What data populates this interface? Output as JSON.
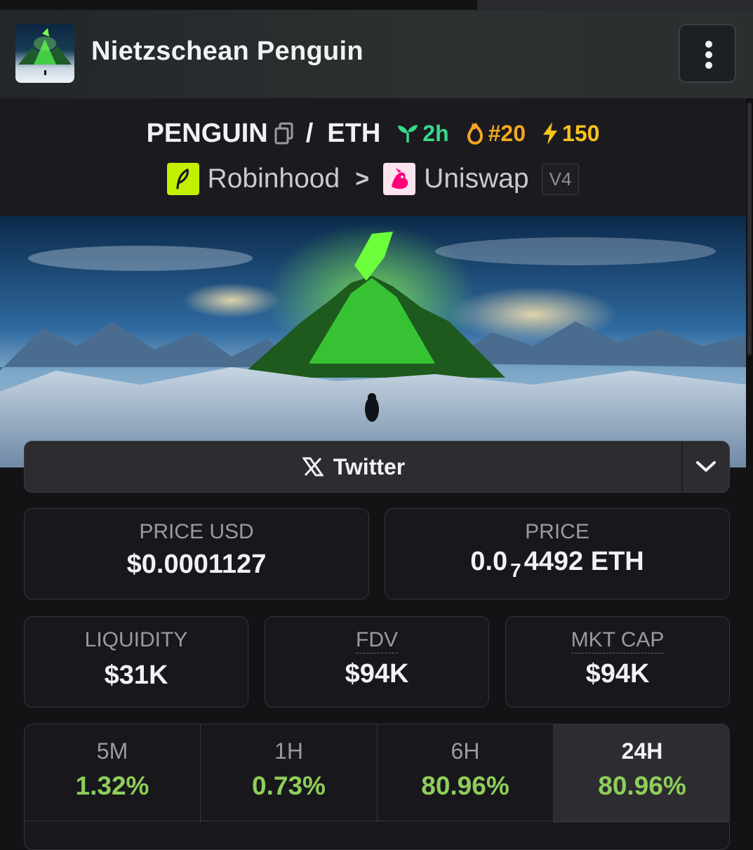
{
  "header": {
    "title": "Nietzschean Penguin"
  },
  "pair": {
    "base": "PENGUIN",
    "quote": "ETH",
    "age": "2h",
    "rank": "#20",
    "boosts": "150"
  },
  "dex": {
    "chain": "Robinhood",
    "name": "Uniswap",
    "version": "V4"
  },
  "socials": {
    "twitter_label": "Twitter"
  },
  "stats": {
    "price_usd_label": "PRICE USD",
    "price_usd": "$0.0001127",
    "price_label": "PRICE",
    "price_lead": "0.0",
    "price_zeros": "7",
    "price_tail": "4492 ETH",
    "liquidity_label": "LIQUIDITY",
    "liquidity": "$31K",
    "fdv_label": "FDV",
    "fdv": "$94K",
    "mktcap_label": "MKT CAP",
    "mktcap": "$94K"
  },
  "changes": [
    {
      "period": "5M",
      "value": "1.32%"
    },
    {
      "period": "1H",
      "value": "0.73%"
    },
    {
      "period": "6H",
      "value": "80.96%"
    },
    {
      "period": "24H",
      "value": "80.96%",
      "active": true
    }
  ],
  "colors": {
    "accent_green": "#39d98a",
    "rank_orange": "#f5a623",
    "boost_yellow": "#f8c21c",
    "change_green": "#8fce5a",
    "robinhood_green": "#c2f000",
    "uniswap_pink": "#ff007a"
  },
  "icons": {
    "copy": "copy-icon",
    "age": "seedling-icon",
    "rank": "flame-icon",
    "boost": "lightning-icon",
    "menu": "kebab-menu-icon",
    "twitter": "x-logo-icon",
    "expand": "chevron-down-icon"
  }
}
